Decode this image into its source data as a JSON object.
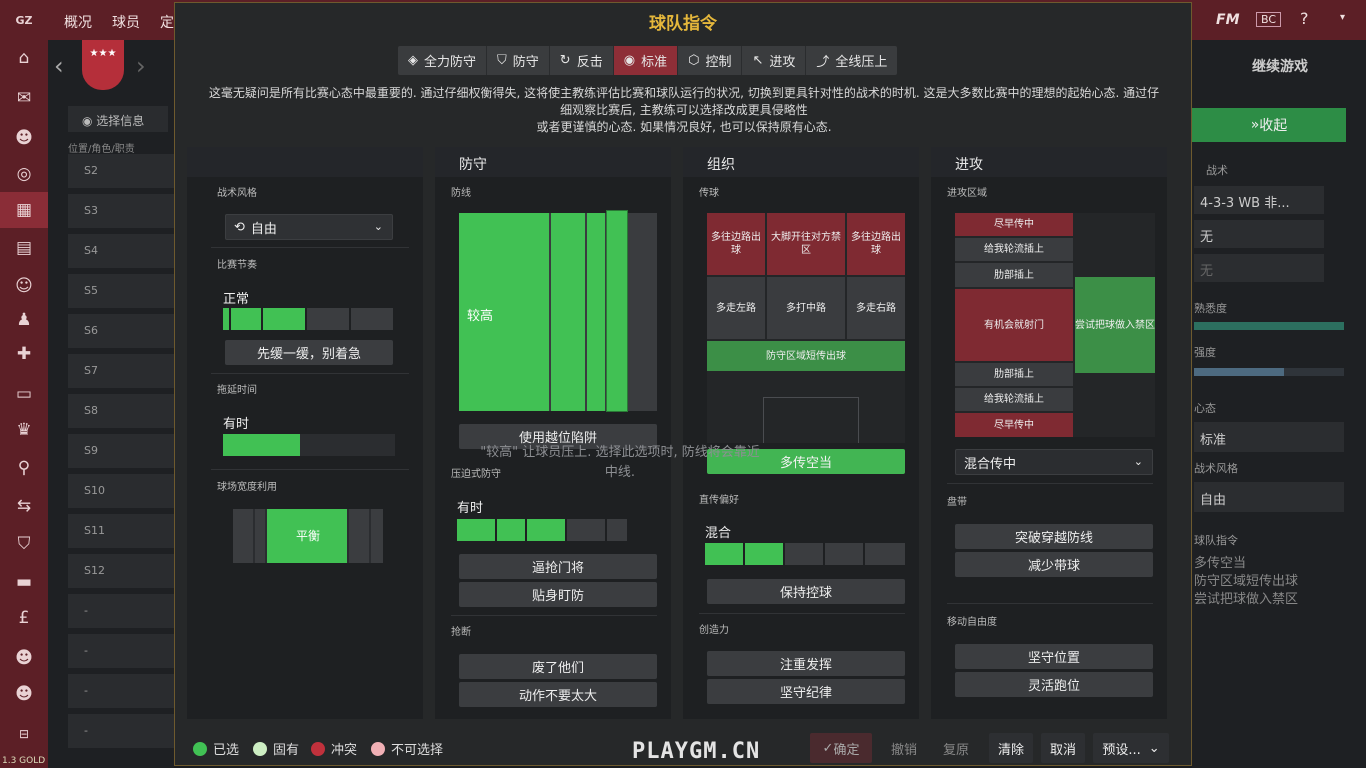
{
  "topbar": {
    "tab_overview": "概况",
    "tab_players": "球员",
    "tab_more": "定",
    "right_label": "继续游戏",
    "collapse": "收起"
  },
  "left": {
    "select_info": "选择信息",
    "col_header": "位置/角色/职责",
    "rows": [
      "S2",
      "S3",
      "S4",
      "S5",
      "S6",
      "S7",
      "S8",
      "S9",
      "S10",
      "S11",
      "S12",
      "-",
      "-",
      "-",
      "-"
    ],
    "version": "1.3 GOLD"
  },
  "right": {
    "tactic_label": "战术",
    "formation": "4-3-3 WB 非...",
    "none1": "无",
    "none2": "无",
    "fit_label": "熟悉度",
    "label2": "强度",
    "mentality_label": "心态",
    "mentality_value": "标准",
    "style_label": "战术风格",
    "style_value": "自由",
    "instr_label": "球队指令",
    "instr1": "多传空当",
    "instr2": "防守区域短传出球",
    "instr3": "尝试把球做入禁区"
  },
  "modal": {
    "title": "球队指令",
    "mentalities": [
      {
        "label": "全力防守",
        "icon": "◈"
      },
      {
        "label": "防守",
        "icon": "⛉"
      },
      {
        "label": "反击",
        "icon": "↻"
      },
      {
        "label": "标准",
        "icon": "◉"
      },
      {
        "label": "控制",
        "icon": "⬡"
      },
      {
        "label": "进攻",
        "icon": "↖"
      },
      {
        "label": "全线压上",
        "icon": "⤴"
      }
    ],
    "description1": "这毫无疑问是所有比赛心态中最重要的. 通过仔细权衡得失, 这将使主教练评估比赛和球队运行的状况, 切换到更具针对性的战术的时机. 这是大多数比赛中的理想的起始心态. 通过仔",
    "description2": "细观察比赛后, 主教练可以选择改成更具侵略性",
    "description3": "或者更谨慎的心态. 如果情况良好, 也可以保持原有心态.",
    "general": {
      "style_label": "战术风格",
      "style_value": "自由",
      "tempo_label": "比赛节奏",
      "tempo_value": "正常",
      "tempo_button": "先缓一缓，别着急",
      "timewasting_label": "拖延时间",
      "timewasting_value": "有时",
      "width_label": "球场宽度利用",
      "width_value": "平衡"
    },
    "defence": {
      "header": "防守",
      "line_label": "防线",
      "line_value": "较高",
      "offside_button": "使用越位陷阱",
      "hint": "\"较高\" 让球员压上. 选择此选项时, 防线将会靠近中线.",
      "press_label": "压迫式防守",
      "press_value": "有时",
      "gk_button": "逼抢门将",
      "mark_button": "贴身盯防",
      "tackle_label": "抢断",
      "tackle1": "废了他们",
      "tackle2": "动作不要太大"
    },
    "buildup": {
      "header": "组织",
      "pass_label": "传球",
      "cells": [
        "多往边路出球",
        "大脚开往对方禁区",
        "多往边路出球",
        "多走左路",
        "多打中路",
        "多走右路"
      ],
      "short_gk": "防守区域短传出球",
      "space_button": "多传空当",
      "direct_label": "直传偏好",
      "direct_value": "混合",
      "keep_button": "保持控球",
      "creative_label": "创造力",
      "creative1": "注重发挥",
      "creative2": "坚守纪律"
    },
    "attack": {
      "header": "进攻",
      "zone_label": "进攻区域",
      "left_cells": [
        "尽早传中",
        "给我轮流插上",
        "肋部插上",
        "有机会就射门",
        "肋部插上",
        "给我轮流插上",
        "尽早传中"
      ],
      "box_cell": "尝试把球做入禁区",
      "cross_value": "混合传中",
      "dribble_label": "盘带",
      "dribble1": "突破穿越防线",
      "dribble2": "减少带球",
      "freedom_label": "移动自由度",
      "freedom1": "坚守位置",
      "freedom2": "灵活跑位"
    },
    "legend": {
      "selected": "已选",
      "inherent": "固有",
      "conflict": "冲突",
      "unavailable": "不可选择"
    },
    "footer": {
      "confirm": "确定",
      "undo": "撤销",
      "redo": "复原",
      "clear": "清除",
      "cancel": "取消",
      "preset": "预设..."
    },
    "watermark": "PLAYGM.CN"
  },
  "colors": {
    "accent_gold": "#e5b73b",
    "selected_green": "#41c154",
    "conflict_red": "#c0313c",
    "brand_red": "#5c1f26"
  },
  "tempo_fill": 0.4,
  "timewasting_fill": 0.45,
  "press_fill": 0.55,
  "direct_fill": 0.4
}
